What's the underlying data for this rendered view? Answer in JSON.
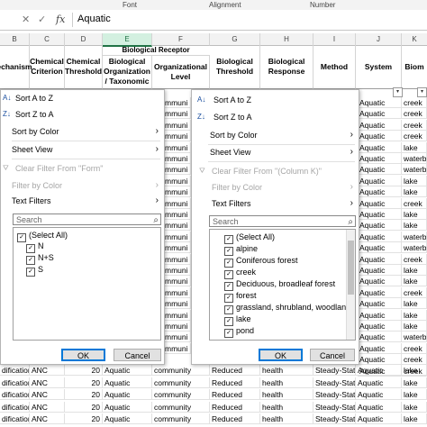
{
  "ribbon": {
    "groups": [
      "Font",
      "Alignment",
      "Number"
    ]
  },
  "formula_bar": {
    "value": "Aquatic",
    "fx": "fx",
    "cancel_glyph": "✕",
    "enter_glyph": "✓"
  },
  "columns": {
    "B": "B",
    "C": "C",
    "D": "D",
    "E": "E",
    "F": "F",
    "G": "G",
    "H": "H",
    "I": "I",
    "J": "J",
    "K": "K"
  },
  "headers": {
    "mechanism": "echanism",
    "chem_criterion": "Chemical Criterion",
    "chem_threshold": "Chemical Threshold",
    "bio_receptor": "Biological Receptor",
    "bio_org": "Biological Organization / Taxonomic",
    "org_level": "Organizational Level",
    "bio_threshold": "Biological Threshold",
    "bio_response": "Biological Response",
    "method": "Method",
    "system": "System",
    "biome": "Biom"
  },
  "dropdown_glyph": "▾",
  "background_cells": {
    "f_col": [
      "mmuni",
      "mmuni",
      "mmuni",
      "mmuni",
      "mmuni",
      "mmuni",
      "mmuni",
      "mmuni",
      "mmuni",
      "mmuni",
      "mmuni",
      "mmuni",
      "mmuni",
      "mmuni",
      "mmuni",
      "mmuni",
      "mmuni",
      "mmuni",
      "mmuni",
      "mmuni",
      "mmuni",
      "mmuni",
      "mmuni"
    ],
    "j_col": [
      "Aquatic",
      "Aquatic",
      "Aquatic",
      "Aquatic",
      "Aquatic",
      "Aquatic",
      "Aquatic",
      "Aquatic",
      "Aquatic",
      "Aquatic",
      "Aquatic",
      "Aquatic",
      "Aquatic",
      "Aquatic",
      "Aquatic",
      "Aquatic",
      "Aquatic",
      "Aquatic",
      "Aquatic",
      "Aquatic",
      "Aquatic",
      "Aquatic",
      "Aquatic",
      "Aquatic",
      "Aquatic"
    ],
    "k_col": [
      "creek",
      "creek",
      "creek",
      "creek",
      "lake",
      "waterbo",
      "waterbo",
      "lake",
      "lake",
      "creek",
      "lake",
      "lake",
      "waterbo",
      "waterbo",
      "creek",
      "lake",
      "lake",
      "creek",
      "lake",
      "lake",
      "lake",
      "waterbo",
      "creek",
      "creek",
      "creek"
    ]
  },
  "bottom_rows": [
    {
      "b": "dification",
      "c": "ANC",
      "d": "20",
      "e": "Aquatic",
      "f": "community",
      "g": "Reduced",
      "h": "health",
      "i": "Steady-State",
      "j": "Aquatic",
      "k": "lake"
    },
    {
      "b": "dification",
      "c": "ANC",
      "d": "20",
      "e": "Aquatic",
      "f": "community",
      "g": "Reduced",
      "h": "health",
      "i": "Steady-State",
      "j": "Aquatic",
      "k": "lake"
    },
    {
      "b": "dification",
      "c": "ANC",
      "d": "20",
      "e": "Aquatic",
      "f": "community",
      "g": "Reduced",
      "h": "health",
      "i": "Steady-State",
      "j": "Aquatic",
      "k": "lake"
    },
    {
      "b": "dification",
      "c": "ANC",
      "d": "20",
      "e": "Aquatic",
      "f": "community",
      "g": "Reduced",
      "h": "health",
      "i": "Steady-State",
      "j": "Aquatic",
      "k": "lake"
    },
    {
      "b": "dification",
      "c": "ANC",
      "d": "20",
      "e": "Aquatic",
      "f": "community",
      "g": "Reduced",
      "h": "health",
      "i": "Steady-State",
      "j": "Aquatic",
      "k": "lake"
    }
  ],
  "menu_left": {
    "sort_az": "Sort A to Z",
    "sort_za": "Sort Z to A",
    "sort_color": "Sort by Color",
    "sheet_view": "Sheet View",
    "clear_filter": "Clear Filter From \"Form\"",
    "filter_color": "Filter by Color",
    "text_filters": "Text Filters",
    "search_placeholder": "Search",
    "items": [
      "(Select All)",
      "N",
      "N+S",
      "S"
    ],
    "ok": "OK",
    "cancel": "Cancel"
  },
  "menu_right": {
    "sort_az": "Sort A to Z",
    "sort_za": "Sort Z to A",
    "sort_color": "Sort by Color",
    "sheet_view": "Sheet View",
    "clear_filter": "Clear Filter From \"(Column K)\"",
    "filter_color": "Filter by Color",
    "text_filters": "Text Filters",
    "search_placeholder": "Search",
    "items": [
      "(Select All)",
      "alpine",
      "Coniferous forest",
      "creek",
      "Deciduous, broadleaf forest",
      "forest",
      "grassland, shrubland, woodland",
      "lake",
      "pond"
    ],
    "ok": "OK",
    "cancel": "Cancel"
  },
  "icons": {
    "check": "✓",
    "arrow": "›",
    "search": "⌕",
    "funnel": "⛛"
  }
}
